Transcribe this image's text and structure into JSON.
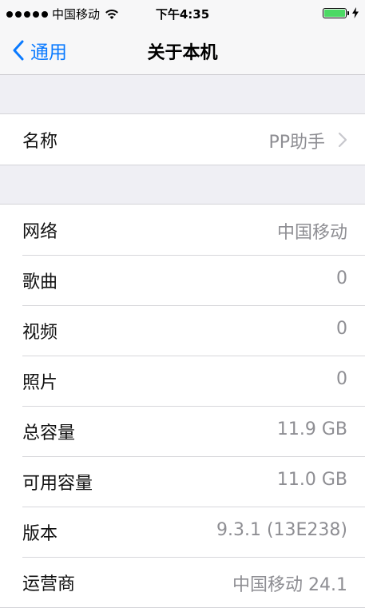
{
  "status_bar": {
    "carrier": "中国移动",
    "time": "下午4:35",
    "battery_color": "#4cd964"
  },
  "nav": {
    "back_label": "通用",
    "title": "关于本机"
  },
  "name_row": {
    "label": "名称",
    "value": "PP助手"
  },
  "info_rows": [
    {
      "label": "网络",
      "value": "中国移动"
    },
    {
      "label": "歌曲",
      "value": "0"
    },
    {
      "label": "视频",
      "value": "0"
    },
    {
      "label": "照片",
      "value": "0"
    },
    {
      "label": "总容量",
      "value": "11.9 GB"
    },
    {
      "label": "可用容量",
      "value": "11.0 GB"
    },
    {
      "label": "版本",
      "value": "9.3.1 (13E238)"
    },
    {
      "label": "运营商",
      "value": "中国移动 24.1"
    }
  ],
  "colors": {
    "accent": "#0a7aff",
    "background": "#efeff4"
  }
}
